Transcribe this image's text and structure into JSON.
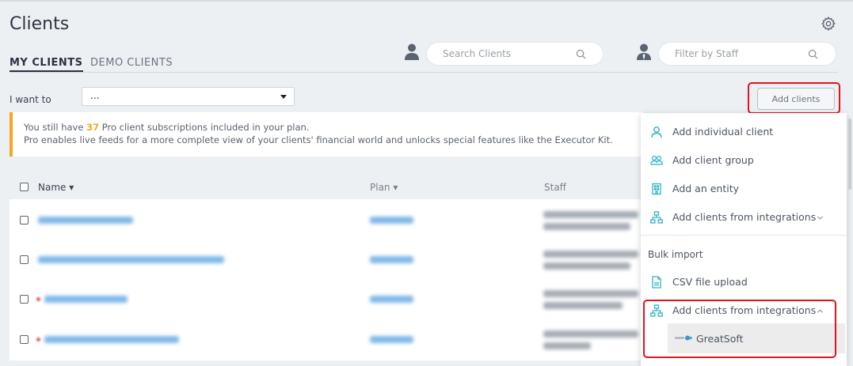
{
  "page": {
    "title": "Clients"
  },
  "tabs": [
    {
      "label": "MY CLIENTS",
      "active": true
    },
    {
      "label": "DEMO CLIENTS",
      "active": false
    }
  ],
  "search_clients": {
    "placeholder": "Search Clients",
    "icon": "person-icon"
  },
  "filter_staff": {
    "placeholder": "Filter by Staff",
    "icon": "staff-icon"
  },
  "action": {
    "label": "I want to",
    "selected": "..."
  },
  "add_button": {
    "label": "Add clients"
  },
  "banner": {
    "line1_prefix": "You still have ",
    "count": "37",
    "line1_suffix": " Pro client subscriptions included in your plan.",
    "line2": "Pro enables live feeds for a more complete view of your clients' financial world and unlocks special features like the Executor Kit."
  },
  "table": {
    "columns": [
      {
        "label": "Name",
        "sort": "▾"
      },
      {
        "label": "Plan",
        "sort": "▾"
      },
      {
        "label": "Staff"
      }
    ],
    "row_count": 4
  },
  "dropdown": {
    "items": [
      {
        "label": "Add individual client",
        "icon": "person-outline-icon"
      },
      {
        "label": "Add client group",
        "icon": "group-icon"
      },
      {
        "label": "Add an entity",
        "icon": "building-icon"
      },
      {
        "label": "Add clients from integrations",
        "icon": "network-icon",
        "chevron": "down"
      }
    ],
    "section_label": "Bulk import",
    "bulk_items": [
      {
        "label": "CSV file upload",
        "icon": "csv-file-icon"
      },
      {
        "label": "Add clients from integrations",
        "icon": "network-icon",
        "chevron": "up"
      }
    ],
    "sub_item": {
      "label": "GreatSoft",
      "icon": "greatsoft-logo-icon"
    }
  },
  "colors": {
    "accent": "#2fb3c6",
    "warning": "#f5a623",
    "highlight": "#e2141b"
  }
}
